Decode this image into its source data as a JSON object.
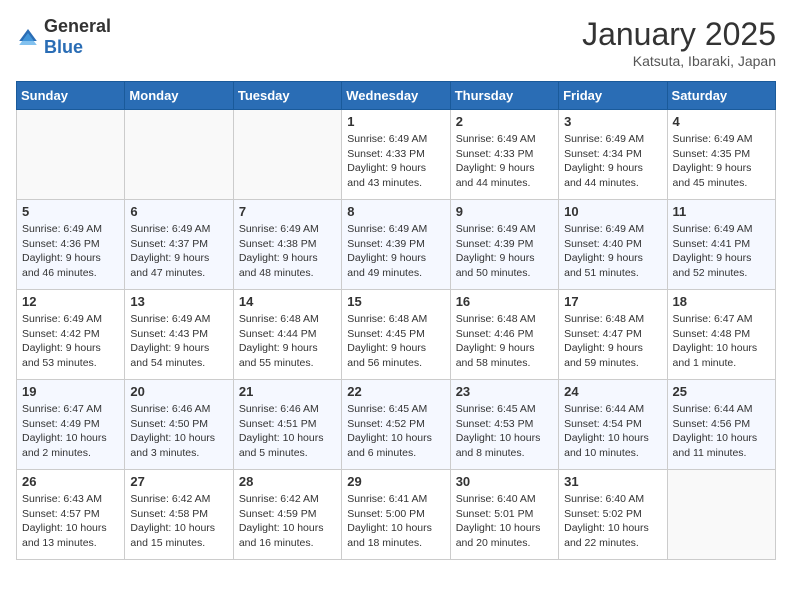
{
  "header": {
    "logo_general": "General",
    "logo_blue": "Blue",
    "title": "January 2025",
    "subtitle": "Katsuta, Ibaraki, Japan"
  },
  "days_of_week": [
    "Sunday",
    "Monday",
    "Tuesday",
    "Wednesday",
    "Thursday",
    "Friday",
    "Saturday"
  ],
  "weeks": [
    [
      {
        "day": "",
        "info": ""
      },
      {
        "day": "",
        "info": ""
      },
      {
        "day": "",
        "info": ""
      },
      {
        "day": "1",
        "info": "Sunrise: 6:49 AM\nSunset: 4:33 PM\nDaylight: 9 hours and 43 minutes."
      },
      {
        "day": "2",
        "info": "Sunrise: 6:49 AM\nSunset: 4:33 PM\nDaylight: 9 hours and 44 minutes."
      },
      {
        "day": "3",
        "info": "Sunrise: 6:49 AM\nSunset: 4:34 PM\nDaylight: 9 hours and 44 minutes."
      },
      {
        "day": "4",
        "info": "Sunrise: 6:49 AM\nSunset: 4:35 PM\nDaylight: 9 hours and 45 minutes."
      }
    ],
    [
      {
        "day": "5",
        "info": "Sunrise: 6:49 AM\nSunset: 4:36 PM\nDaylight: 9 hours and 46 minutes."
      },
      {
        "day": "6",
        "info": "Sunrise: 6:49 AM\nSunset: 4:37 PM\nDaylight: 9 hours and 47 minutes."
      },
      {
        "day": "7",
        "info": "Sunrise: 6:49 AM\nSunset: 4:38 PM\nDaylight: 9 hours and 48 minutes."
      },
      {
        "day": "8",
        "info": "Sunrise: 6:49 AM\nSunset: 4:39 PM\nDaylight: 9 hours and 49 minutes."
      },
      {
        "day": "9",
        "info": "Sunrise: 6:49 AM\nSunset: 4:39 PM\nDaylight: 9 hours and 50 minutes."
      },
      {
        "day": "10",
        "info": "Sunrise: 6:49 AM\nSunset: 4:40 PM\nDaylight: 9 hours and 51 minutes."
      },
      {
        "day": "11",
        "info": "Sunrise: 6:49 AM\nSunset: 4:41 PM\nDaylight: 9 hours and 52 minutes."
      }
    ],
    [
      {
        "day": "12",
        "info": "Sunrise: 6:49 AM\nSunset: 4:42 PM\nDaylight: 9 hours and 53 minutes."
      },
      {
        "day": "13",
        "info": "Sunrise: 6:49 AM\nSunset: 4:43 PM\nDaylight: 9 hours and 54 minutes."
      },
      {
        "day": "14",
        "info": "Sunrise: 6:48 AM\nSunset: 4:44 PM\nDaylight: 9 hours and 55 minutes."
      },
      {
        "day": "15",
        "info": "Sunrise: 6:48 AM\nSunset: 4:45 PM\nDaylight: 9 hours and 56 minutes."
      },
      {
        "day": "16",
        "info": "Sunrise: 6:48 AM\nSunset: 4:46 PM\nDaylight: 9 hours and 58 minutes."
      },
      {
        "day": "17",
        "info": "Sunrise: 6:48 AM\nSunset: 4:47 PM\nDaylight: 9 hours and 59 minutes."
      },
      {
        "day": "18",
        "info": "Sunrise: 6:47 AM\nSunset: 4:48 PM\nDaylight: 10 hours and 1 minute."
      }
    ],
    [
      {
        "day": "19",
        "info": "Sunrise: 6:47 AM\nSunset: 4:49 PM\nDaylight: 10 hours and 2 minutes."
      },
      {
        "day": "20",
        "info": "Sunrise: 6:46 AM\nSunset: 4:50 PM\nDaylight: 10 hours and 3 minutes."
      },
      {
        "day": "21",
        "info": "Sunrise: 6:46 AM\nSunset: 4:51 PM\nDaylight: 10 hours and 5 minutes."
      },
      {
        "day": "22",
        "info": "Sunrise: 6:45 AM\nSunset: 4:52 PM\nDaylight: 10 hours and 6 minutes."
      },
      {
        "day": "23",
        "info": "Sunrise: 6:45 AM\nSunset: 4:53 PM\nDaylight: 10 hours and 8 minutes."
      },
      {
        "day": "24",
        "info": "Sunrise: 6:44 AM\nSunset: 4:54 PM\nDaylight: 10 hours and 10 minutes."
      },
      {
        "day": "25",
        "info": "Sunrise: 6:44 AM\nSunset: 4:56 PM\nDaylight: 10 hours and 11 minutes."
      }
    ],
    [
      {
        "day": "26",
        "info": "Sunrise: 6:43 AM\nSunset: 4:57 PM\nDaylight: 10 hours and 13 minutes."
      },
      {
        "day": "27",
        "info": "Sunrise: 6:42 AM\nSunset: 4:58 PM\nDaylight: 10 hours and 15 minutes."
      },
      {
        "day": "28",
        "info": "Sunrise: 6:42 AM\nSunset: 4:59 PM\nDaylight: 10 hours and 16 minutes."
      },
      {
        "day": "29",
        "info": "Sunrise: 6:41 AM\nSunset: 5:00 PM\nDaylight: 10 hours and 18 minutes."
      },
      {
        "day": "30",
        "info": "Sunrise: 6:40 AM\nSunset: 5:01 PM\nDaylight: 10 hours and 20 minutes."
      },
      {
        "day": "31",
        "info": "Sunrise: 6:40 AM\nSunset: 5:02 PM\nDaylight: 10 hours and 22 minutes."
      },
      {
        "day": "",
        "info": ""
      }
    ]
  ]
}
